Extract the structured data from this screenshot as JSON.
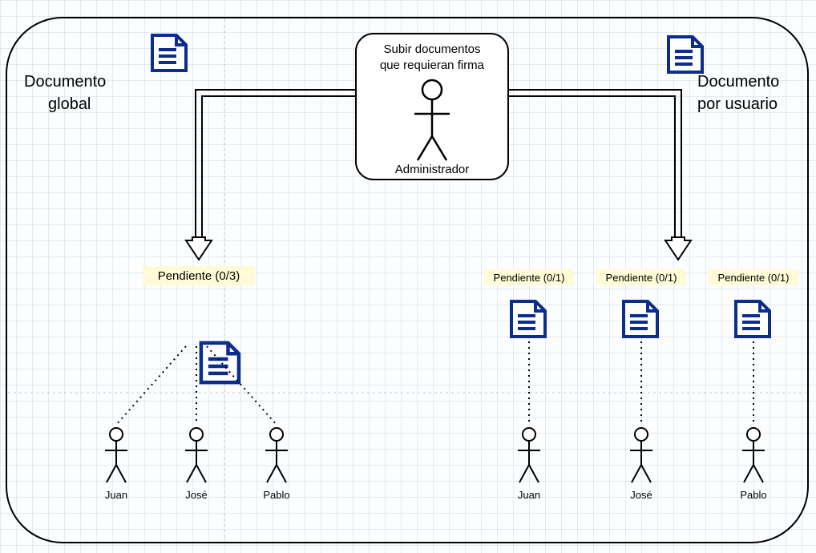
{
  "admin_box": {
    "line1": "Subir documentos",
    "line2": "que requieran firma",
    "role": "Administrador"
  },
  "left": {
    "title_line1": "Documento",
    "title_line2": "global",
    "pending": "Pendiente (0/3)",
    "users": [
      "Juan",
      "José",
      "Pablo"
    ]
  },
  "right": {
    "title_line1": "Documento",
    "title_line2": "por usuario",
    "items": [
      {
        "pending": "Pendiente (0/1)",
        "user": "Juan"
      },
      {
        "pending": "Pendiente (0/1)",
        "user": "José"
      },
      {
        "pending": "Pendiente (0/1)",
        "user": "Pablo"
      }
    ]
  }
}
